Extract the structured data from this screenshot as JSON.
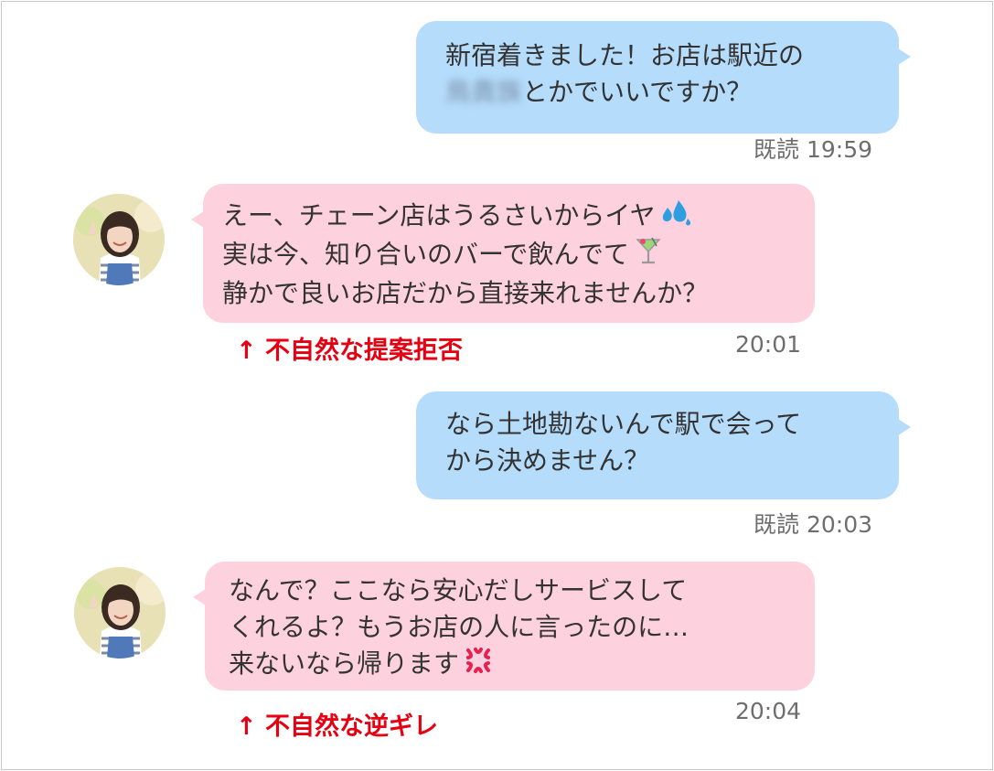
{
  "messages": [
    {
      "side": "sent",
      "lines": [
        "新宿着きました！お店は駅近の",
        "とかでいいですか？"
      ],
      "blurred_text": "鳥貴族",
      "read_label": "既読",
      "time": "19:59"
    },
    {
      "side": "received",
      "lines": [
        "えー、チェーン店はうるさいからイヤ",
        "実は今、知り合いのバーで飲んでて",
        "静かで良いお店だから直接来れませんか？"
      ],
      "emojis": [
        "sweat-drops-icon",
        "cocktail-glass-icon"
      ],
      "time": "20:01",
      "annotation": "↑ 不自然な提案拒否"
    },
    {
      "side": "sent",
      "lines": [
        "なら土地勘ないんで駅で会って",
        "から決めません？"
      ],
      "read_label": "既読",
      "time": "20:03"
    },
    {
      "side": "received",
      "lines": [
        "なんで？ここなら安心だしサービスして",
        "くれるよ？もうお店の人に言ったのに…",
        "来ないなら帰ります"
      ],
      "emojis": [
        "anger-symbol-icon"
      ],
      "time": "20:04",
      "annotation": "↑ 不自然な逆ギレ"
    }
  ],
  "colors": {
    "sent_bubble": "#b5dcfb",
    "received_bubble": "#fed1de",
    "annotation": "#e60012",
    "meta_text": "#6e6e6e"
  }
}
